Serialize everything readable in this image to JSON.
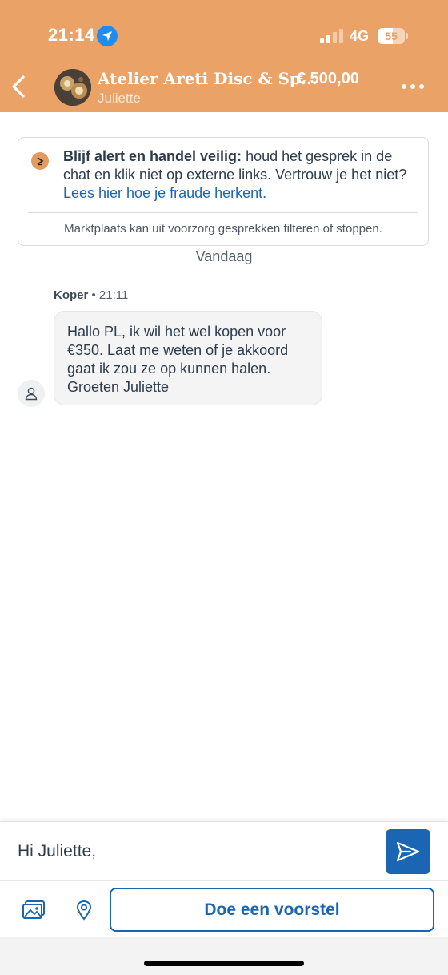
{
  "status_bar": {
    "time": "21:14",
    "network": "4G",
    "battery": "55",
    "battery_level": 0.55
  },
  "header": {
    "listing_title": "Atelier Areti Disc & Sp...",
    "price": "€ 500,00",
    "user_name": "Juliette"
  },
  "notice": {
    "bold_text": "Blijf alert en handel veilig:",
    "text": " houd het gesprek in de chat en klik niet op externe links. Vertrouw je het niet? ",
    "link_text": "Lees hier hoe je fraude herkent.",
    "footer": "Marktplaats kan uit voorzorg gesprekken filteren of stoppen."
  },
  "day_label": "Vandaag",
  "messages": [
    {
      "sender": "Koper",
      "time": "• 21:11",
      "text": "Hallo PL, ik wil het wel kopen voor €350. Laat me weten of je akkoord gaat ik zou ze op kunnen halen. Groeten Juliette"
    }
  ],
  "composer": {
    "input_value": "Hi Juliette,",
    "proposal_label": "Doe een voorstel"
  },
  "colors": {
    "header_bg": "#eba266",
    "accent_blue": "#1b66b3",
    "bubble_bg": "#f4f4f4"
  },
  "icons": {
    "back": "chevron-left-icon",
    "more": "more-dots-icon",
    "send": "send-icon",
    "photo": "photo-icon",
    "location": "location-pin-icon",
    "user": "user-icon",
    "notice": "alert-icon"
  }
}
